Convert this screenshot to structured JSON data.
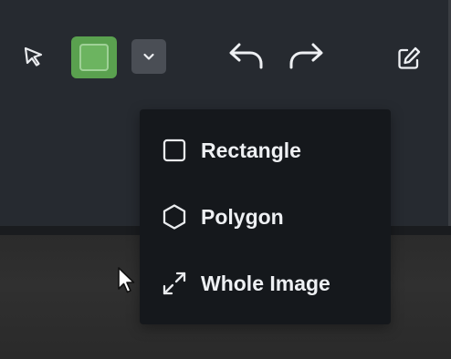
{
  "toolbar": {
    "tools": {
      "select_icon": "cursor-arrow-icon",
      "color_swatch_color": "#5aa14f",
      "dropdown_icon": "chevron-down-icon",
      "undo_icon": "undo-icon",
      "redo_icon": "redo-icon",
      "edit_icon": "edit-icon"
    }
  },
  "shape_menu": {
    "items": [
      {
        "label": "Rectangle",
        "icon": "square-icon"
      },
      {
        "label": "Polygon",
        "icon": "hexagon-icon"
      },
      {
        "label": "Whole Image",
        "icon": "expand-arrows-icon"
      }
    ]
  },
  "colors": {
    "toolbar_bg": "#262a30",
    "menu_bg": "#15181c",
    "accent_green": "#5aa14f"
  }
}
